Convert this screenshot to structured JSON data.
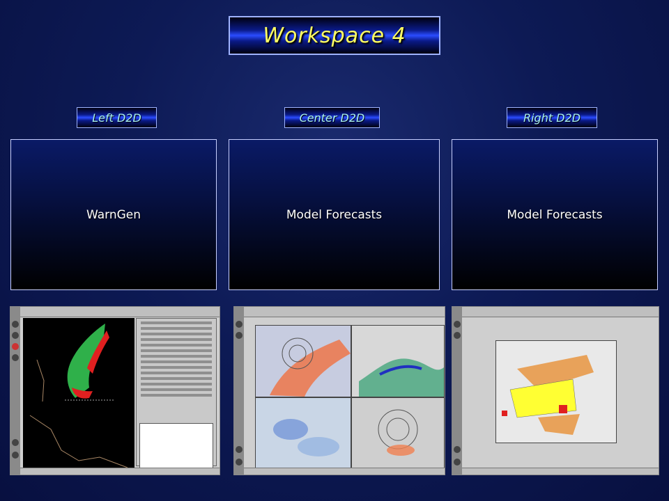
{
  "title": "Workspace 4",
  "columns": [
    {
      "label": "Left D2D",
      "panel_text": "WarnGen",
      "screenshot": "warngen-screenshot"
    },
    {
      "label": "Center D2D",
      "panel_text": "Model Forecasts",
      "screenshot": "model-forecasts-four-panel-screenshot"
    },
    {
      "label": "Right D2D",
      "panel_text": "Model Forecasts",
      "screenshot": "model-forecasts-warning-screenshot"
    }
  ],
  "colors": {
    "title_text": "#ffff66",
    "label_text": "#a8f0f0",
    "radar_red": "#e02020",
    "radar_green": "#2fb04a",
    "warn_yellow": "#ffff33",
    "warn_orange": "#e8a25a"
  }
}
